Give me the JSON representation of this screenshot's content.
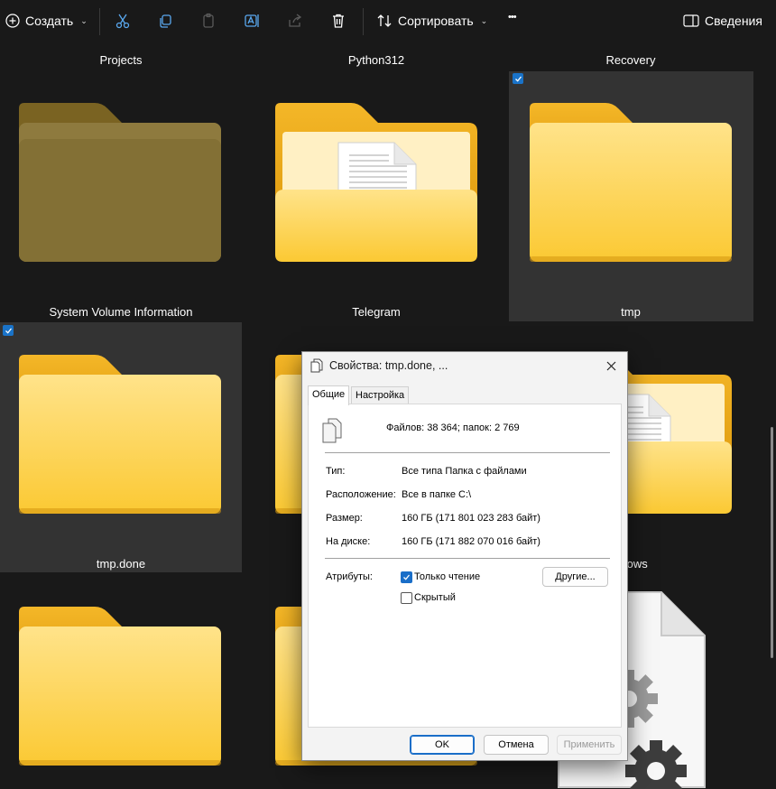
{
  "toolbar": {
    "create_label": "Создать",
    "sort_label": "Сортировать",
    "more_label": "•••",
    "details_label": "Сведения",
    "icons": [
      "add-icon",
      "cut-icon",
      "copy-icon",
      "paste-icon",
      "rename-icon",
      "share-icon",
      "delete-icon",
      "sort-icon",
      "details-pane-icon"
    ]
  },
  "items": [
    {
      "name": "Projects",
      "selected": false
    },
    {
      "name": "Python312",
      "selected": false
    },
    {
      "name": "Recovery",
      "selected": false
    },
    {
      "name": "System Volume Information",
      "selected": false
    },
    {
      "name": "Telegram",
      "selected": false
    },
    {
      "name": "tmp",
      "selected": true
    },
    {
      "name": "tmp.done",
      "selected": true
    },
    {
      "name": "Windows",
      "selected": false,
      "partial_label": "ndows"
    }
  ],
  "dialog": {
    "title": "Свойства: tmp.done, ...",
    "tabs": [
      "Общие",
      "Настройка"
    ],
    "active_tab": "Общие",
    "summary": "Файлов: 38 364; папок: 2 769",
    "rows": [
      {
        "label": "Тип:",
        "value": "Все типа Папка с файлами"
      },
      {
        "label": "Расположение:",
        "value": "Все в папке C:\\"
      },
      {
        "label": "Размер:",
        "value": "160 ГБ (171 801 023 283 байт)"
      },
      {
        "label": "На диске:",
        "value": "160 ГБ (171 882 070 016 байт)"
      }
    ],
    "attributes_label": "Атрибуты:",
    "readonly_label": "Только чтение",
    "readonly_checked": true,
    "hidden_label": "Скрытый",
    "hidden_checked": false,
    "other_button": "Другие...",
    "ok_button": "OK",
    "cancel_button": "Отмена",
    "apply_button": "Применить"
  },
  "colors": {
    "background": "#191919",
    "selection": "#333333",
    "accent": "#1a6ec8",
    "folder_back": "#f0b829",
    "folder_front": "#ffd561"
  }
}
